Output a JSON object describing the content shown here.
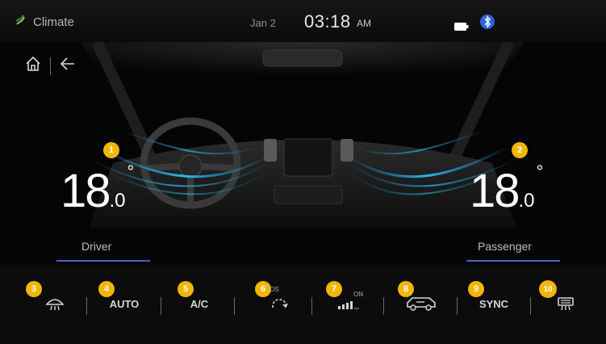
{
  "status": {
    "app_title": "Climate",
    "date": "Jan 2",
    "time": "03:18",
    "ampm": "AM"
  },
  "zones": {
    "driver": {
      "temp_main": "18",
      "temp_sub": ".0",
      "degree": "°",
      "label": "Driver"
    },
    "passenger": {
      "temp_main": "18",
      "temp_sub": ".0",
      "degree": "°",
      "label": "Passenger"
    }
  },
  "controls": {
    "auto_label": "AUTO",
    "ac_label": "A/C",
    "sync_label": "SYNC",
    "recirc_os_label": "OS",
    "fan_on_label": "ON"
  },
  "badges": [
    "1",
    "2",
    "3",
    "4",
    "5",
    "6",
    "7",
    "8",
    "9",
    "10"
  ],
  "colors": {
    "badge": "#f2b600",
    "airflow": "#2ec4ff",
    "underline": "#4a63c4"
  },
  "icons": [
    "climate-icon",
    "battery-icon",
    "bluetooth-icon",
    "home-icon",
    "back-arrow-icon",
    "front-defrost-icon",
    "air-recirculation-icon",
    "fan-speed-icon",
    "car-air-intake-icon",
    "rear-defrost-icon"
  ]
}
